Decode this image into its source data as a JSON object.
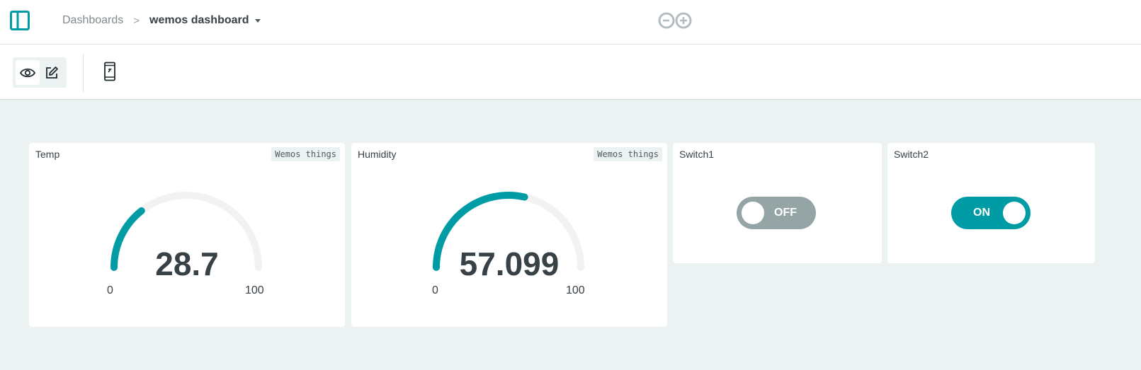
{
  "header": {
    "breadcrumb_root": "Dashboards",
    "breadcrumb_separator": ">",
    "dashboard_name": "wemos dashboard"
  },
  "colors": {
    "accent": "#009ca6",
    "toggle_off": "#95a5a6",
    "gauge_track": "#f2f2f2",
    "background": "#ecf1f1"
  },
  "toolbar": {
    "icons": [
      "eye-icon",
      "pencil-icon",
      "mobile-device-icon"
    ]
  },
  "widgets": [
    {
      "title": "Temp",
      "tag": "Wemos things",
      "type": "gauge",
      "value": "28.7",
      "value_num": 28.7,
      "min": "0",
      "max": "100"
    },
    {
      "title": "Humidity",
      "tag": "Wemos things",
      "type": "gauge",
      "value": "57.099",
      "value_num": 57.099,
      "min": "0",
      "max": "100"
    },
    {
      "title": "Switch1",
      "type": "switch",
      "state": "OFF"
    },
    {
      "title": "Switch2",
      "type": "switch",
      "state": "ON"
    }
  ]
}
